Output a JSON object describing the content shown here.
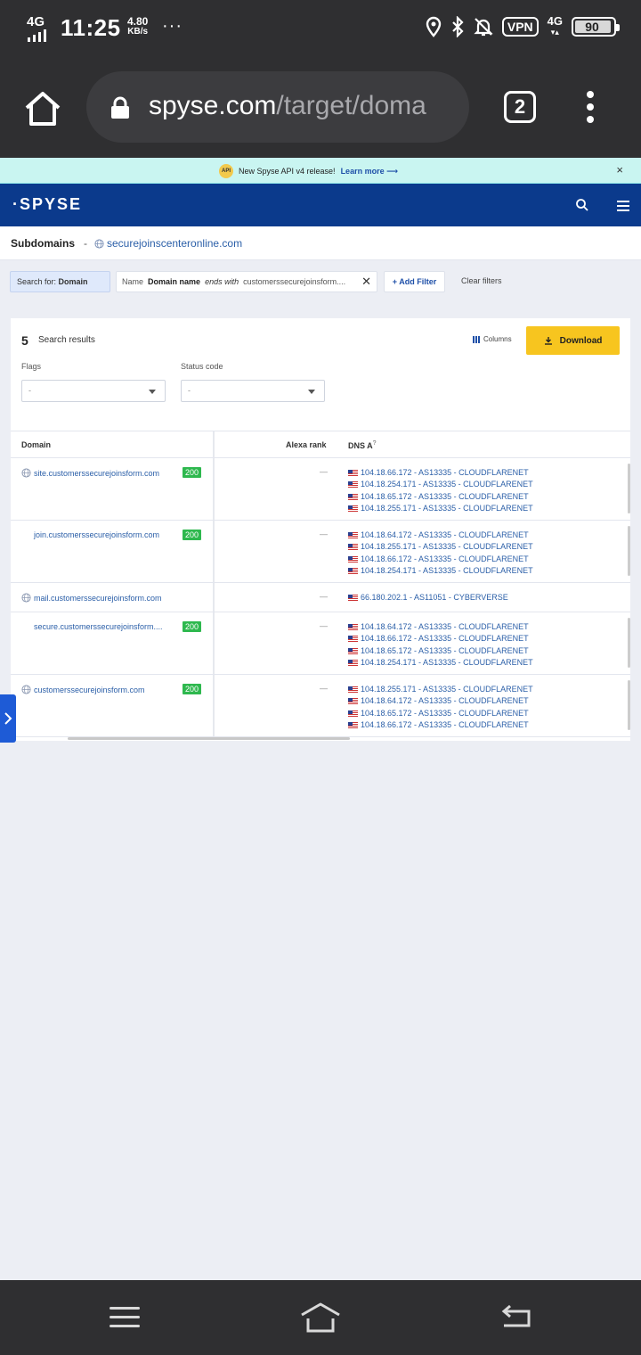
{
  "status_bar": {
    "network": "4G",
    "time": "11:25",
    "speed_value": "4.80",
    "speed_unit": "KB/s",
    "more": "···",
    "vpn": "VPN",
    "network2": "4G",
    "battery": "90"
  },
  "browser": {
    "url_host": "spyse.com",
    "url_path": "/target/doma",
    "tab_count": "2"
  },
  "announcement": {
    "badge": "API",
    "text": "New Spyse API v4 release!",
    "link": "Learn more ⟶",
    "close": "×"
  },
  "header": {
    "logo": "·SPYSE"
  },
  "breadcrumb": {
    "title": "Subdomains",
    "separator": "-",
    "domain": "securejoinscenteronline.com"
  },
  "filters": {
    "search_for_label": "Search for:",
    "search_for_value": "Domain",
    "chip_field": "Name",
    "chip_name": "Domain name",
    "chip_operator": "ends with",
    "chip_value": "customerssecurejoinsform....",
    "chip_close": "✕",
    "add_filter": "+ Add Filter",
    "clear_filters": "Clear filters"
  },
  "results": {
    "count": "5",
    "label": "Search results",
    "columns_label": "Columns",
    "download_label": "Download",
    "flags_label": "Flags",
    "flags_value": "-",
    "status_label": "Status code",
    "status_value": "-"
  },
  "table": {
    "headers": {
      "domain": "Domain",
      "alexa": "Alexa rank",
      "dns": "DNS A",
      "dns_help": "?"
    },
    "rows": [
      {
        "domain": "site.customerssecurejoinsform.com",
        "status": "200",
        "alexa": "—",
        "dns": [
          "104.18.66.172 - AS13335 - CLOUDFLARENET",
          "104.18.254.171 - AS13335 - CLOUDFLARENET",
          "104.18.65.172 - AS13335 - CLOUDFLARENET",
          "104.18.255.171 - AS13335 - CLOUDFLARENET"
        ]
      },
      {
        "domain": "join.customerssecurejoinsform.com",
        "status": "200",
        "alexa": "—",
        "dns": [
          "104.18.64.172 - AS13335 - CLOUDFLARENET",
          "104.18.255.171 - AS13335 - CLOUDFLARENET",
          "104.18.66.172 - AS13335 - CLOUDFLARENET",
          "104.18.254.171 - AS13335 - CLOUDFLARENET"
        ]
      },
      {
        "domain": "mail.customerssecurejoinsform.com",
        "status": "",
        "alexa": "—",
        "dns": [
          "66.180.202.1 - AS11051 - CYBERVERSE"
        ]
      },
      {
        "domain": "secure.customerssecurejoinsform....",
        "status": "200",
        "alexa": "—",
        "dns": [
          "104.18.64.172 - AS13335 - CLOUDFLARENET",
          "104.18.66.172 - AS13335 - CLOUDFLARENET",
          "104.18.65.172 - AS13335 - CLOUDFLARENET",
          "104.18.254.171 - AS13335 - CLOUDFLARENET"
        ]
      },
      {
        "domain": "customerssecurejoinsform.com",
        "status": "200",
        "alexa": "—",
        "dns": [
          "104.18.255.171 - AS13335 - CLOUDFLARENET",
          "104.18.64.172 - AS13335 - CLOUDFLARENET",
          "104.18.65.172 - AS13335 - CLOUDFLARENET",
          "104.18.66.172 - AS13335 - CLOUDFLARENET"
        ]
      }
    ]
  }
}
